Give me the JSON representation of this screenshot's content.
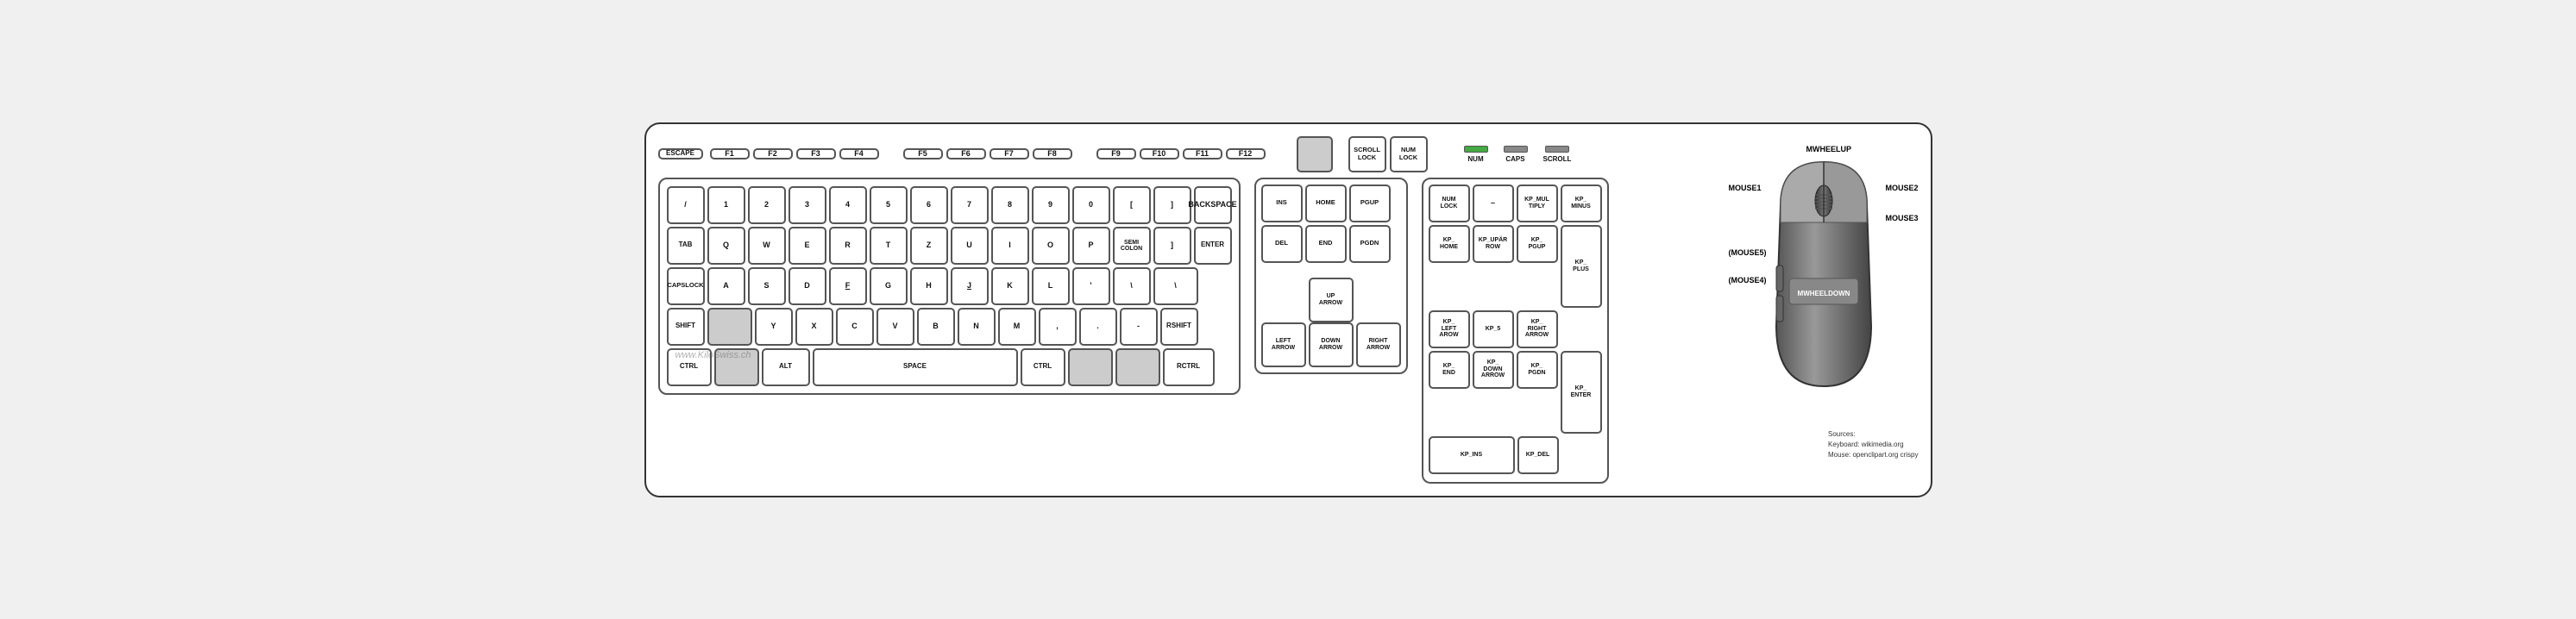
{
  "keyboard": {
    "fn_row": {
      "escape": "ESCAPE",
      "f1": "F1",
      "f2": "F2",
      "f3": "F3",
      "f4": "F4",
      "f5": "F5",
      "f6": "F6",
      "f7": "F7",
      "f8": "F8",
      "f9": "F9",
      "f10": "F10",
      "f11": "F11",
      "f12": "F12",
      "prtscr": "SCROLL\nLOCK",
      "numlock": "NUM\nLOCK"
    },
    "leds": {
      "num": "NUM",
      "caps": "CAPS",
      "scroll": "SCROLL"
    },
    "num_row": {
      "slash": "/",
      "1": "1",
      "2": "2",
      "3": "3",
      "4": "4",
      "5": "5",
      "6": "6",
      "7": "7",
      "8": "8",
      "9": "9",
      "0": "0",
      "bracket_l": "[",
      "bracket_r": "]",
      "backspace": "BACKSPACE"
    },
    "qwerty_row": {
      "tab": "TAB",
      "q": "Q",
      "w": "W",
      "e": "E",
      "r": "R",
      "t": "T",
      "z": "Z",
      "u": "U",
      "i": "I",
      "o": "O",
      "p": "P",
      "semi": "SEMI\nCOLON",
      "bracket_r": "]",
      "enter": "ENTER"
    },
    "asdf_row": {
      "capslock": "CAPSLOCK",
      "a": "A",
      "s": "S",
      "d": "D",
      "f": "F",
      "g": "G",
      "h": "H",
      "j": "J",
      "k": "K",
      "l": "L",
      "quote": "'",
      "backslash": "\\",
      "backslash2": "\\"
    },
    "zxcv_row": {
      "shift": "SHIFT",
      "y": "Y",
      "x": "X",
      "c": "C",
      "v": "V",
      "b": "B",
      "n": "N",
      "m": "M",
      "comma": ",",
      "period": ".",
      "minus": "-",
      "rshift": "RSHIFT"
    },
    "bottom_row": {
      "ctrl": "CTRL",
      "alt": "ALT",
      "space": "SPACE",
      "ctrl2": "CTRL",
      "rctrl": "RCTRL"
    },
    "nav": {
      "ins": "INS",
      "home": "HOME",
      "pgup": "PGUP",
      "del": "DEL",
      "end": "END",
      "pgdn": "PGDN",
      "up": "UP\nARROW",
      "left": "LEFT\nARROW",
      "down": "DOWN\nARROW",
      "right": "RIGHT\nARROW"
    },
    "numpad": {
      "numlock": "NUM\nLOCK",
      "minus": "–",
      "kp_mul": "KP_MUL\nTIPLY",
      "kp_minus": "KP_\nMINUS",
      "kp_home": "KP_\nHOME",
      "kp_uparrow": "KP_UPÄR\nROW",
      "kp_pgup": "KP_\nPGUP",
      "kp_plus": "KP_\nPLUS",
      "kp_left": "KP_\nLEFT\nAROW",
      "kp_5": "KP_5",
      "kp_right": "KP_\nRIGHT\nARROW",
      "kp_end": "KP_\nEND",
      "kp_down": "KP_\nDOWN\nARROW",
      "kp_pgdn": "KP_\nPGDN",
      "kp_enter": "KP_\nENTER",
      "kp_ins": "KP_INS",
      "kp_del": "KP_DEL"
    }
  },
  "mouse": {
    "labels": {
      "mwheelup": "MWHEELUP",
      "mouse1": "MOUSE1",
      "mouse2": "MOUSE2",
      "mouse3": "MOUSE3",
      "mouse4": "(MOUSE4)",
      "mouse5": "(MOUSE5)",
      "mwheeldown": "MWHEELDOWN"
    },
    "sources": {
      "title": "Sources:",
      "keyboard": "Keyboard: wikimedia.org",
      "mouse": "Mouse: openclipart.org crispy"
    }
  },
  "watermark": "www.KiloSwiss.ch"
}
